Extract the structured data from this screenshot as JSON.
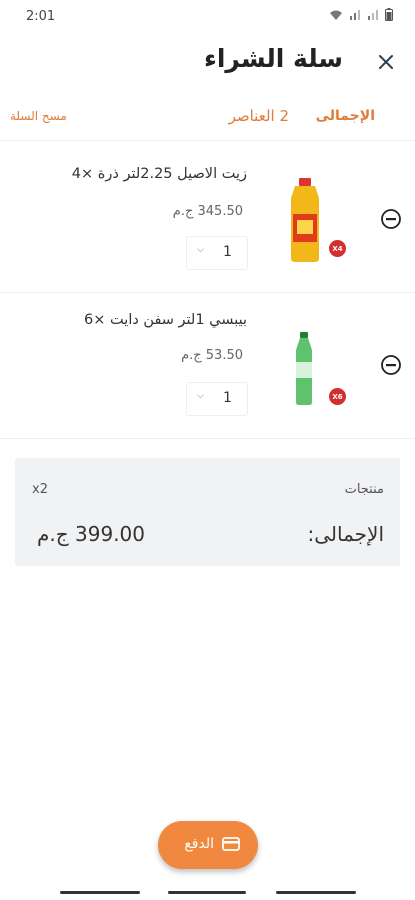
{
  "status": {
    "time": "2:01"
  },
  "header": {
    "title": "سلة الشراء"
  },
  "summary": {
    "total_label": "الإجمالى",
    "items_count_text": "2 العناصر",
    "clear_label": "مسح السلة"
  },
  "items": [
    {
      "name": "زيت الاصيل 2.25لتر ذرة ×4",
      "price": "345.50 ج.م",
      "qty": "1",
      "badge": "X4"
    },
    {
      "name": "بيبسي 1لتر سفن دايت ×6",
      "price": "53.50 ج.م",
      "qty": "1",
      "badge": "X6"
    }
  ],
  "summary_card": {
    "products_label": "منتجات",
    "products_count": "x2",
    "total_label": "الإجمالى:",
    "total_value": "399.00 ج.م"
  },
  "pay": {
    "label": "الدفع"
  },
  "colors": {
    "accent": "#f0893f",
    "accent_text": "#e07b39",
    "badge": "#d32f2f"
  }
}
